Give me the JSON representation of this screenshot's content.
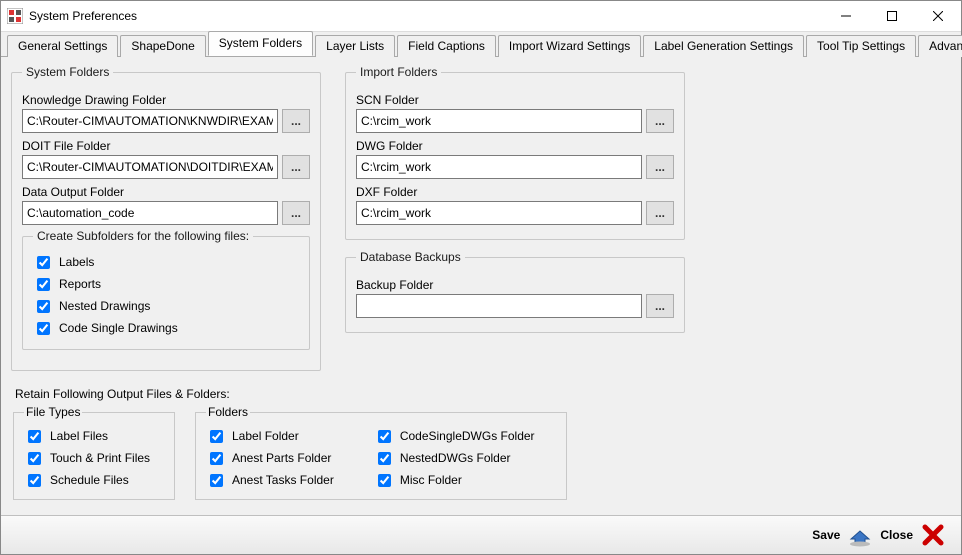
{
  "window": {
    "title": "System Preferences"
  },
  "tabs": [
    "General Settings",
    "ShapeDone",
    "System Folders",
    "Layer Lists",
    "Field Captions",
    "Import Wizard Settings",
    "Label Generation Settings",
    "Tool Tip Settings",
    "Advanced Settings"
  ],
  "active_tab_index": 2,
  "system_folders": {
    "legend": "System Folders",
    "knowledge_label": "Knowledge Drawing Folder",
    "knowledge_value": "C:\\Router-CIM\\AUTOMATION\\KNWDIR\\EXAMPLE",
    "doit_label": "DOIT File Folder",
    "doit_value": "C:\\Router-CIM\\AUTOMATION\\DOITDIR\\EXAMPLE",
    "data_output_label": "Data Output Folder",
    "data_output_value": "C:\\automation_code",
    "subfolders_legend": "Create Subfolders for the following files:",
    "subfolders": [
      {
        "label": "Labels",
        "checked": true
      },
      {
        "label": "Reports",
        "checked": true
      },
      {
        "label": "Nested Drawings",
        "checked": true
      },
      {
        "label": "Code Single Drawings",
        "checked": true
      }
    ],
    "browse": "..."
  },
  "import_folders": {
    "legend": "Import Folders",
    "scn_label": "SCN Folder",
    "scn_value": "C:\\rcim_work",
    "dwg_label": "DWG Folder",
    "dwg_value": "C:\\rcim_work",
    "dxf_label": "DXF Folder",
    "dxf_value": "C:\\rcim_work",
    "browse": "..."
  },
  "db_backups": {
    "legend": "Database Backups",
    "backup_label": "Backup Folder",
    "backup_value": "",
    "browse": "..."
  },
  "retain": {
    "title": "Retain Following Output Files & Folders:",
    "file_types_legend": "File Types",
    "file_types": [
      {
        "label": "Label Files",
        "checked": true
      },
      {
        "label": "Touch & Print Files",
        "checked": true
      },
      {
        "label": "Schedule Files",
        "checked": true
      }
    ],
    "folders_legend": "Folders",
    "folders_col1": [
      {
        "label": "Label Folder",
        "checked": true
      },
      {
        "label": "Anest Parts Folder",
        "checked": true
      },
      {
        "label": "Anest Tasks Folder",
        "checked": true
      }
    ],
    "folders_col2": [
      {
        "label": "CodeSingleDWGs Folder",
        "checked": true
      },
      {
        "label": "NestedDWGs Folder",
        "checked": true
      },
      {
        "label": "Misc Folder",
        "checked": true
      }
    ]
  },
  "footer": {
    "save": "Save",
    "close": "Close"
  }
}
